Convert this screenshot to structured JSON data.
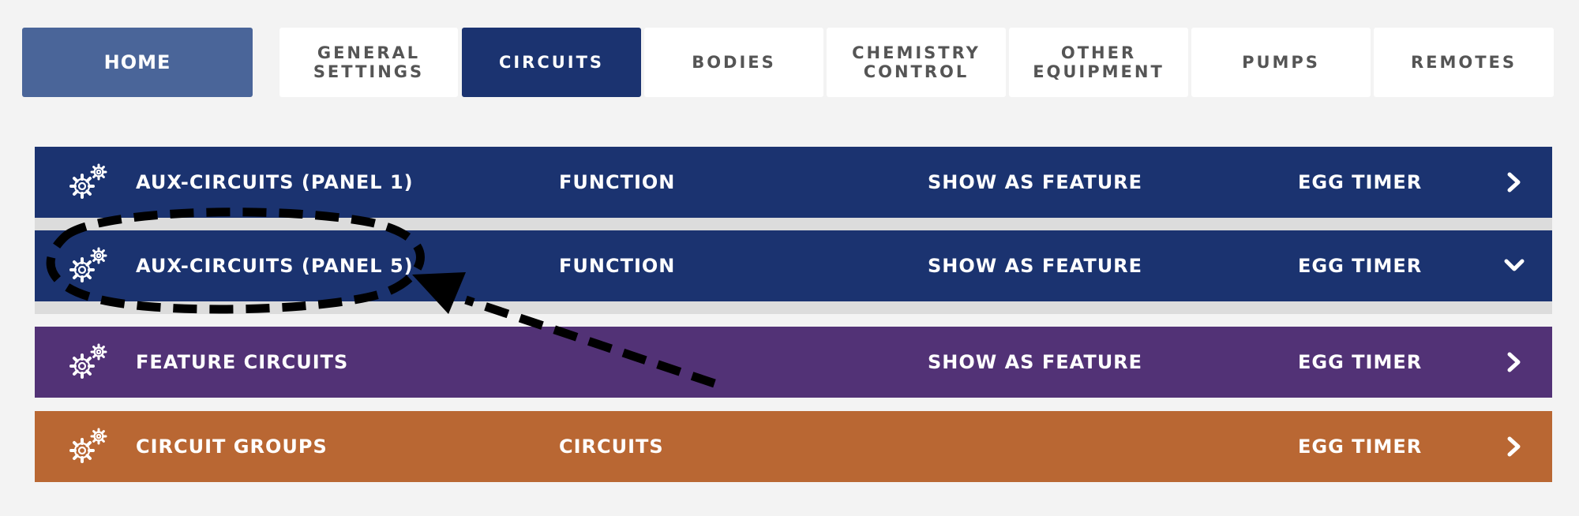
{
  "colors": {
    "page_bg": "#f3f3f3",
    "home_tab_bg": "#4a6599",
    "active_tab_bg": "#1b3370",
    "aux_row_bg": "#1b3370",
    "feature_row_bg": "#523276",
    "groups_row_bg": "#b96733",
    "separator": "#dcdcdc",
    "annotation": "#000000"
  },
  "nav": {
    "tabs": [
      {
        "label": "HOME"
      },
      {
        "label": "GENERAL\nSETTINGS"
      },
      {
        "label": "CIRCUITS"
      },
      {
        "label": "BODIES"
      },
      {
        "label": "CHEMISTRY\nCONTROL"
      },
      {
        "label": "OTHER\nEQUIPMENT"
      },
      {
        "label": "PUMPS"
      },
      {
        "label": "REMOTES"
      }
    ],
    "active": "CIRCUITS"
  },
  "rows": [
    {
      "name": "AUX-CIRCUITS (PANEL 1)",
      "function": "FUNCTION",
      "show": "SHOW AS FEATURE",
      "egg": "EGG TIMER",
      "icon": "gears-icon",
      "chevron": "chevron-right-icon",
      "expanded": false
    },
    {
      "name": "AUX-CIRCUITS (PANEL 5)",
      "function": "FUNCTION",
      "show": "SHOW AS FEATURE",
      "egg": "EGG TIMER",
      "icon": "gears-icon",
      "chevron": "chevron-down-icon",
      "expanded": true
    },
    {
      "name": "FEATURE CIRCUITS",
      "function": "",
      "show": "SHOW AS FEATURE",
      "egg": "EGG TIMER",
      "icon": "gears-icon",
      "chevron": "chevron-right-icon",
      "expanded": false
    },
    {
      "name": "CIRCUIT GROUPS",
      "function": "CIRCUITS",
      "show": "",
      "egg": "EGG TIMER",
      "icon": "gears-icon",
      "chevron": "chevron-right-icon",
      "expanded": false
    }
  ]
}
